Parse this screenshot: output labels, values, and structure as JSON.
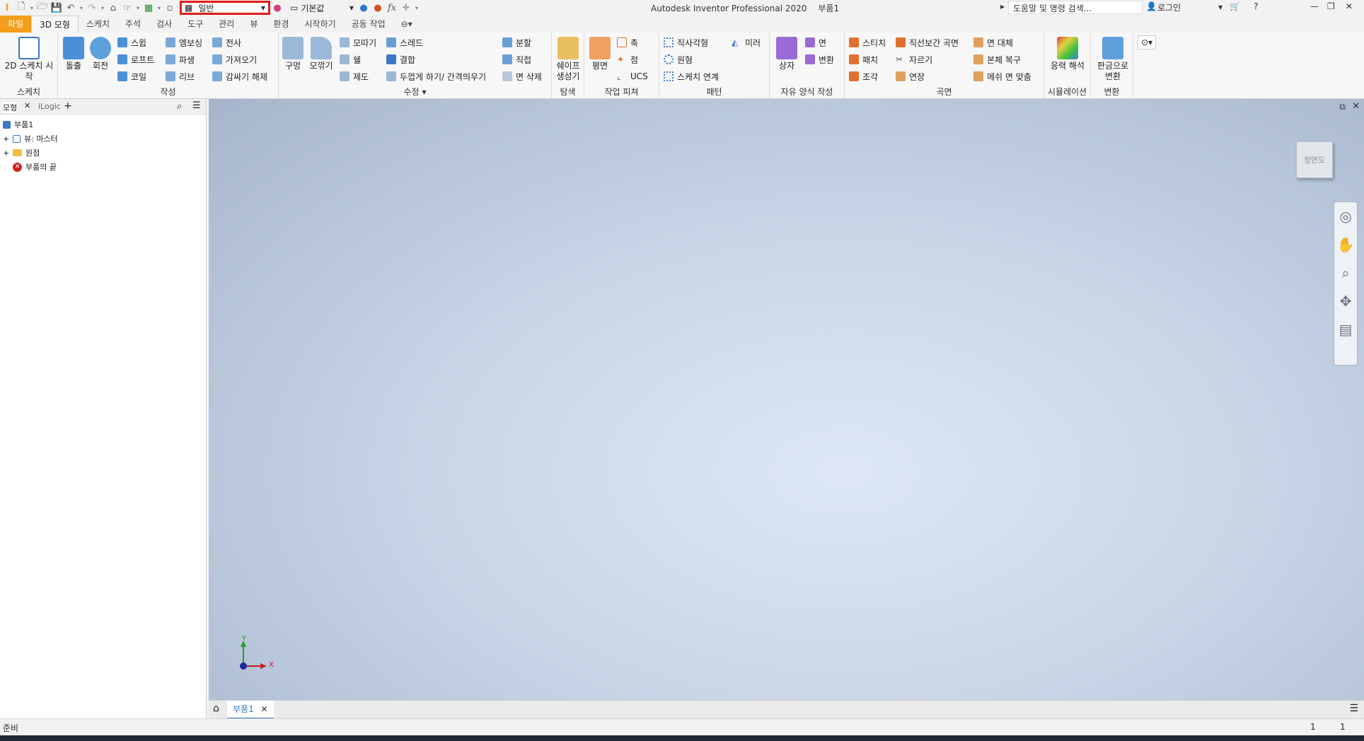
{
  "app": {
    "title": "Autodesk Inventor Professional 2020",
    "document": "부품1"
  },
  "qat": {
    "material": "일반",
    "appearance": "기본값",
    "fx": "fx",
    "search_placeholder": "도움말 및 명령 검색...",
    "login": "로그인"
  },
  "tabs": [
    {
      "label": "파일"
    },
    {
      "label": "3D 모형"
    },
    {
      "label": "스케치"
    },
    {
      "label": "주석"
    },
    {
      "label": "검사"
    },
    {
      "label": "도구"
    },
    {
      "label": "관리"
    },
    {
      "label": "뷰"
    },
    {
      "label": "환경"
    },
    {
      "label": "시작하기"
    },
    {
      "label": "공동 작업"
    }
  ],
  "ribbon": {
    "sketch": {
      "label": "스케치",
      "start": "2D 스케치 시작"
    },
    "create": {
      "label": "작성",
      "extrude": "돌출",
      "revolve": "회전",
      "sweep": "스윕",
      "loft": "로프트",
      "coil": "코일",
      "emboss": "엠보싱",
      "derive": "파생",
      "rib": "리브",
      "decal": "전사",
      "import": "가져오기",
      "unwrap": "감싸기 해제"
    },
    "modify": {
      "label": "수정",
      "hole": "구멍",
      "fillet": "모깎기",
      "chamfer": "모따기",
      "shell": "쉘",
      "draft": "제도",
      "thread": "스레드",
      "combine": "결합",
      "thicken": "두껍게 하기/ 간격띄우기",
      "split": "분할",
      "direct": "직접",
      "delete_face": "면 삭제"
    },
    "explore": {
      "label": "탐색",
      "shape": "쉐이프 생성기"
    },
    "work": {
      "label": "작업 피쳐",
      "plane": "평면",
      "axis": "축",
      "point": "점",
      "ucs": "UCS"
    },
    "pattern": {
      "label": "패턴",
      "rect": "직사각형",
      "circ": "원형",
      "sketch": "스케치 연계",
      "mirror": "미러"
    },
    "freeform": {
      "label": "자유 양식 작성",
      "box": "상자",
      "face": "면",
      "transform": "변환"
    },
    "surface": {
      "label": "곡면",
      "stitch": "스티치",
      "patch": "패치",
      "sculpt": "조각",
      "ruled": "직선보간 곡면",
      "trim": "자르기",
      "extend": "연장",
      "replace": "면 대체",
      "repair": "본체 복구",
      "fit": "메쉬 면 맞춤"
    },
    "sim": {
      "label": "시뮬레이션",
      "stress": "응력 해석"
    },
    "convert": {
      "label": "변환",
      "sheet": "판금으로 변환"
    }
  },
  "browser": {
    "tab_model": "모형",
    "tab_ilogic": "iLogic",
    "add": "+",
    "tree": [
      "부품1",
      "뷰: 마스터",
      "원점",
      "부품의 끝"
    ]
  },
  "viewcube": "정면도",
  "doctab": {
    "label": "부품1"
  },
  "status": {
    "ready": "준비",
    "n1": "1",
    "n2": "1"
  },
  "triad": {
    "x": "X",
    "y": "Y"
  }
}
